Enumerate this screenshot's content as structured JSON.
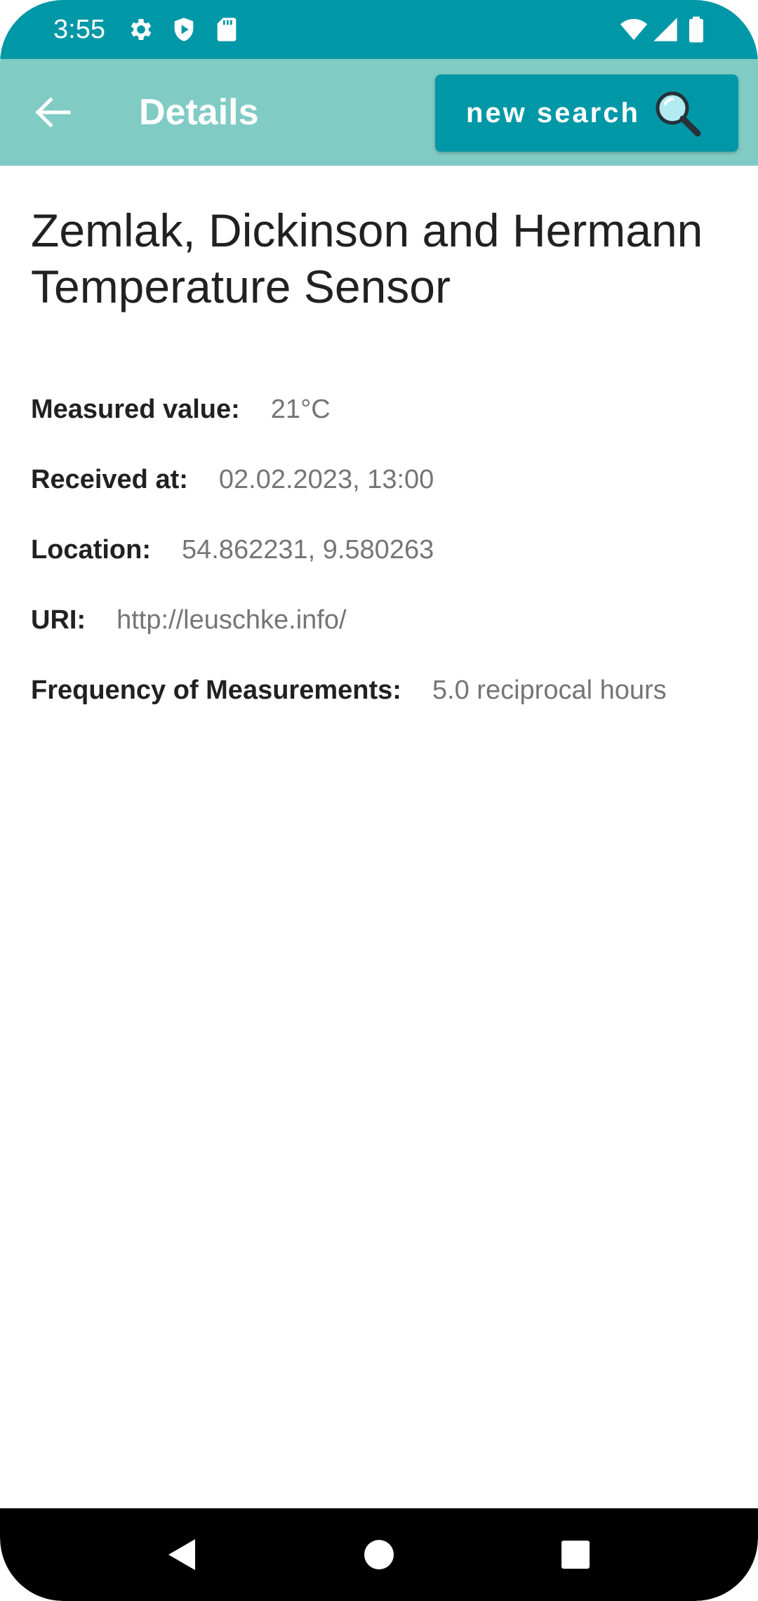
{
  "status_bar": {
    "time": "3:55",
    "icons_left": [
      "gear-icon",
      "shield-icon",
      "sd-card-icon"
    ],
    "icons_right": [
      "wifi-icon",
      "signal-icon",
      "battery-icon"
    ]
  },
  "app_bar": {
    "title": "Details",
    "back_icon": "arrow-left-icon",
    "search_button_label": "new search",
    "search_icon": "magnifier-icon"
  },
  "sensor": {
    "title": "Zemlak, Dickinson and Hermann Temperature Sensor",
    "details": [
      {
        "label": "Measured value:",
        "value": "21°C"
      },
      {
        "label": "Received at:",
        "value": "02.02.2023, 13:00"
      },
      {
        "label": "Location:",
        "value": "54.862231, 9.580263"
      },
      {
        "label": "URI:",
        "value": "http://leuschke.info/"
      },
      {
        "label": "Frequency of Measurements:",
        "value": "5.0 reciprocal hours"
      }
    ]
  },
  "nav_bar": {
    "icons": [
      "back-triangle-icon",
      "home-circle-icon",
      "recents-square-icon"
    ]
  },
  "colors": {
    "status_bar": "#0097a7",
    "app_bar": "#80cbc4",
    "accent": "#0097a7",
    "label_text": "#212121",
    "value_text": "#757575"
  }
}
